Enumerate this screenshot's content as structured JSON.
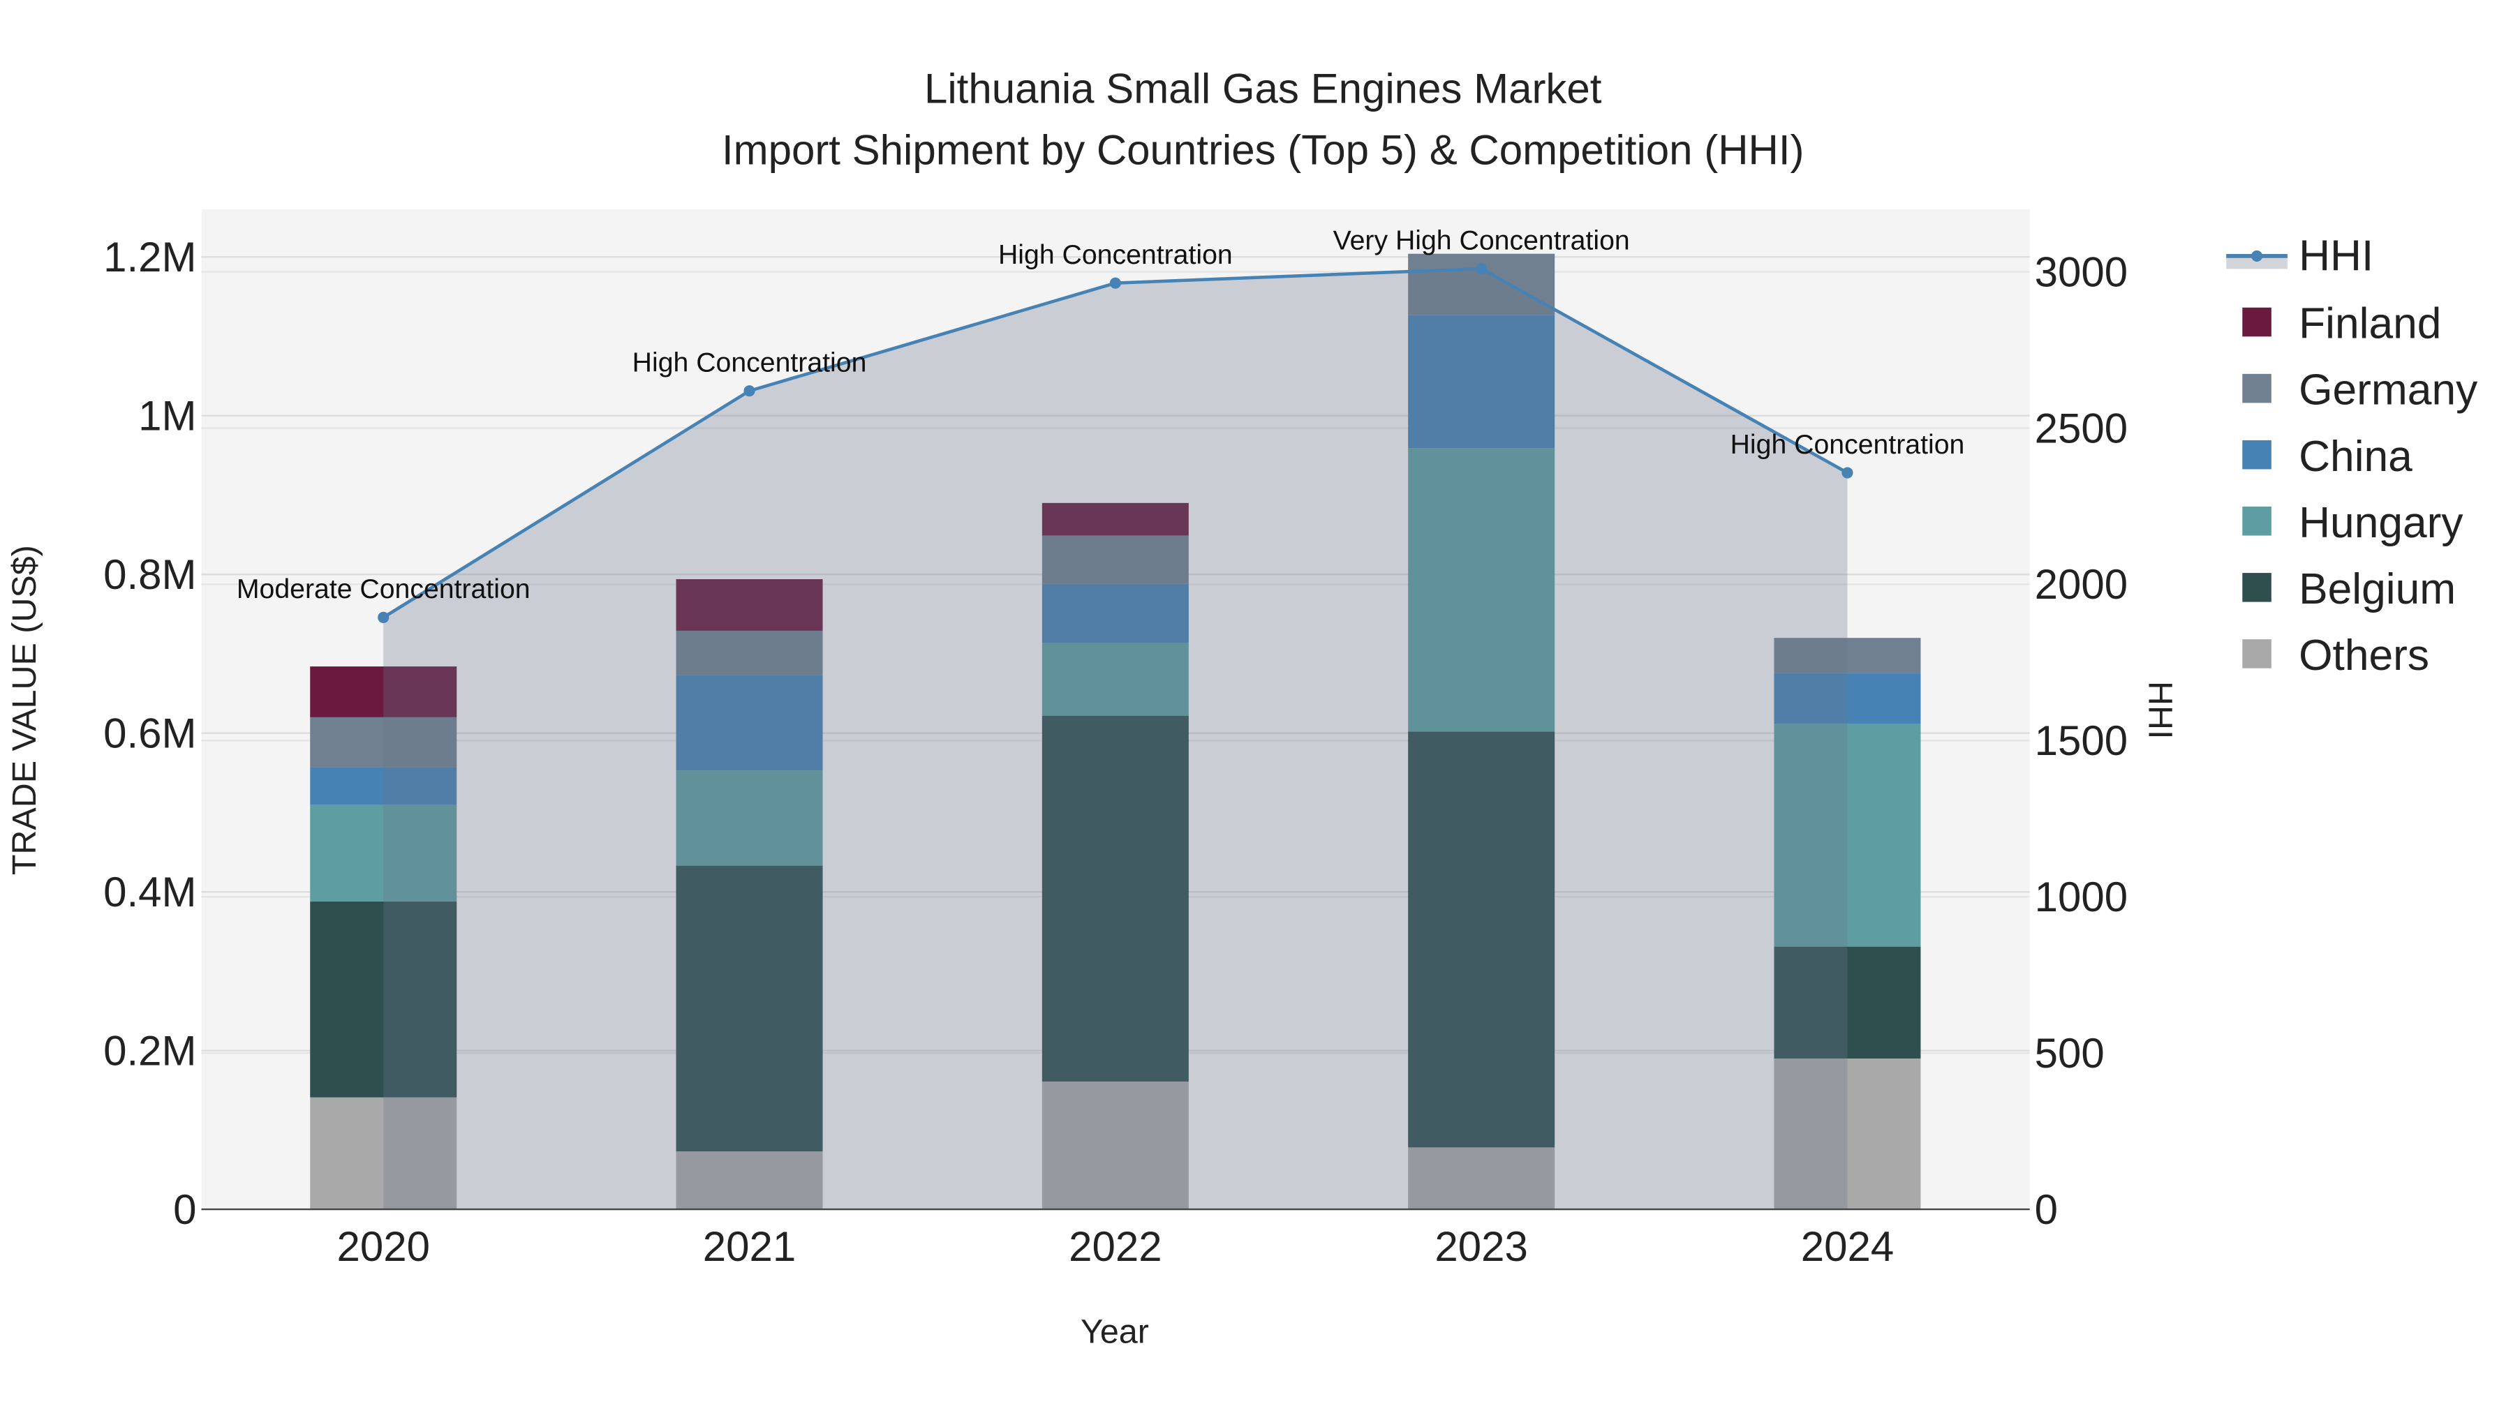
{
  "chart_data": {
    "type": "bar",
    "title_line1": "Lithuania Small Gas Engines Market",
    "title_line2": "Import Shipment by Countries (Top 5) & Competition (HHI)",
    "xlabel": "Year",
    "ylabel": "TRADE VALUE (US$)",
    "y2label": "HHI",
    "categories": [
      "2020",
      "2021",
      "2022",
      "2023",
      "2024"
    ],
    "ylim": [
      0,
      1260000
    ],
    "y2lim": [
      0,
      3200
    ],
    "yticks": [
      {
        "v": 0,
        "label": "0"
      },
      {
        "v": 200000,
        "label": "0.2M"
      },
      {
        "v": 400000,
        "label": "0.4M"
      },
      {
        "v": 600000,
        "label": "0.6M"
      },
      {
        "v": 800000,
        "label": "0.8M"
      },
      {
        "v": 1000000,
        "label": "1M"
      },
      {
        "v": 1200000,
        "label": "1.2M"
      }
    ],
    "y2ticks": [
      {
        "v": 0,
        "label": "0"
      },
      {
        "v": 500,
        "label": "500"
      },
      {
        "v": 1000,
        "label": "1000"
      },
      {
        "v": 1500,
        "label": "1500"
      },
      {
        "v": 2000,
        "label": "2000"
      },
      {
        "v": 2500,
        "label": "2500"
      },
      {
        "v": 3000,
        "label": "3000"
      }
    ],
    "stacked": true,
    "series": [
      {
        "name": "Others",
        "color": "#a9a9a9",
        "values": [
          141000,
          73000,
          161000,
          78000,
          190000
        ]
      },
      {
        "name": "Belgium",
        "color": "#2f4f4f",
        "values": [
          247000,
          360000,
          461000,
          524000,
          141000
        ]
      },
      {
        "name": "Hungary",
        "color": "#5f9ea0",
        "values": [
          122000,
          120000,
          92000,
          357000,
          281000
        ]
      },
      {
        "name": "China",
        "color": "#4682b4",
        "values": [
          47000,
          120000,
          74000,
          168000,
          64000
        ]
      },
      {
        "name": "Germany",
        "color": "#708090",
        "values": [
          63000,
          56000,
          61000,
          77000,
          44000
        ]
      },
      {
        "name": "Finland",
        "color": "#6b1a3f",
        "values": [
          64000,
          65000,
          41000,
          0,
          0
        ]
      }
    ],
    "hhi": {
      "name": "HHI",
      "color": "#4682b4",
      "values": [
        1894,
        2619,
        2964,
        3010,
        2357
      ],
      "annotations": [
        "Moderate Concentration",
        "High Concentration",
        "High Concentration",
        "Very High Concentration",
        "High Concentration"
      ]
    },
    "legend_position": "right",
    "grid": true
  }
}
